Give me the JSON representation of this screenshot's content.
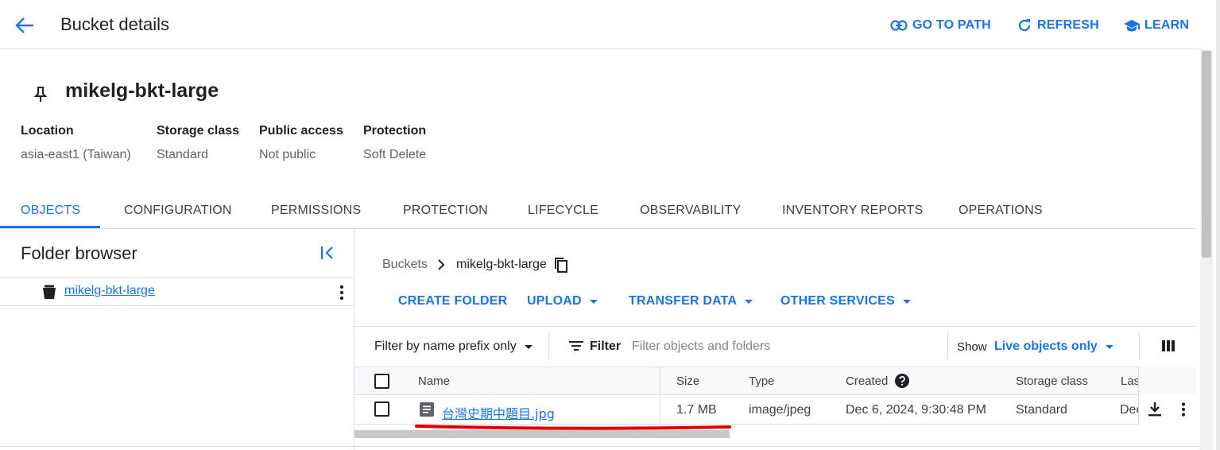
{
  "header": {
    "title": "Bucket details",
    "go_to_path": "GO TO PATH",
    "refresh": "REFRESH",
    "learn": "LEARN"
  },
  "bucket": {
    "name": "mikelg-bkt-large",
    "meta": [
      {
        "label": "Location",
        "value": "asia-east1 (Taiwan)"
      },
      {
        "label": "Storage class",
        "value": "Standard"
      },
      {
        "label": "Public access",
        "value": "Not public"
      },
      {
        "label": "Protection",
        "value": "Soft Delete"
      }
    ]
  },
  "tabs": [
    "OBJECTS",
    "CONFIGURATION",
    "PERMISSIONS",
    "PROTECTION",
    "LIFECYCLE",
    "OBSERVABILITY",
    "INVENTORY REPORTS",
    "OPERATIONS"
  ],
  "folder_browser": {
    "title": "Folder browser",
    "bucket_link": "mikelg-bkt-large"
  },
  "breadcrumb": {
    "root": "Buckets",
    "current": "mikelg-bkt-large"
  },
  "actions": {
    "create_folder": "CREATE FOLDER",
    "upload": "UPLOAD",
    "transfer_data": "TRANSFER DATA",
    "other_services": "OTHER SERVICES"
  },
  "filter_bar": {
    "prefix_select": "Filter by name prefix only",
    "filter_label": "Filter",
    "filter_placeholder": "Filter objects and folders",
    "show_label": "Show",
    "show_value": "Live objects only"
  },
  "table": {
    "columns": [
      "Name",
      "Size",
      "Type",
      "Created",
      "Storage class",
      "Las"
    ],
    "rows": [
      {
        "name": "台灣史期中題目.jpg",
        "size": "1.7 MB",
        "type": "image/jpeg",
        "created": "Dec 6, 2024, 9:30:48 PM",
        "storage_class": "Standard",
        "last_modified_partial": "Dec"
      }
    ]
  },
  "colors": {
    "accent": "#1a73e8",
    "annotation": "#e00000"
  }
}
